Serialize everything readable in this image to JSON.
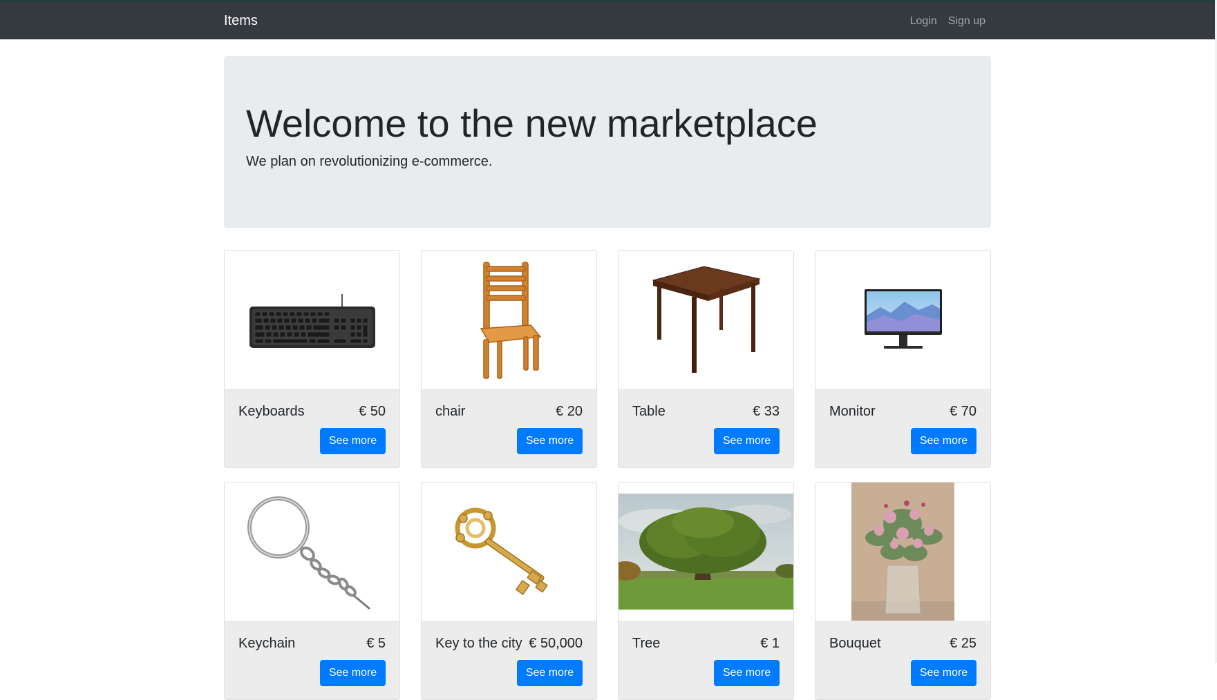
{
  "navbar": {
    "brand": "Items",
    "links": [
      "Login",
      "Sign up"
    ],
    "bg_color": "#343a40"
  },
  "hero": {
    "title": "Welcome to the new marketplace",
    "lead": "We plan on revolutionizing e-commerce.",
    "bg_color": "#e9ecef"
  },
  "items": [
    {
      "name": "Keyboards",
      "price": "€ 50",
      "button": "See more",
      "image": "keyboard-image"
    },
    {
      "name": "chair",
      "price": "€ 20",
      "button": "See more",
      "image": "chair-image"
    },
    {
      "name": "Table",
      "price": "€ 33",
      "button": "See more",
      "image": "table-image"
    },
    {
      "name": "Monitor",
      "price": "€ 70",
      "button": "See more",
      "image": "monitor-image"
    },
    {
      "name": "Keychain",
      "price": "€ 5",
      "button": "See more",
      "image": "keychain-image"
    },
    {
      "name": "Key to the city",
      "price": "€ 50,000",
      "button": "See more",
      "image": "key-image"
    },
    {
      "name": "Tree",
      "price": "€ 1",
      "button": "See more",
      "image": "tree-image"
    },
    {
      "name": "Bouquet",
      "price": "€ 25",
      "button": "See more",
      "image": "bouquet-image"
    }
  ],
  "accent_color": "#007bff"
}
